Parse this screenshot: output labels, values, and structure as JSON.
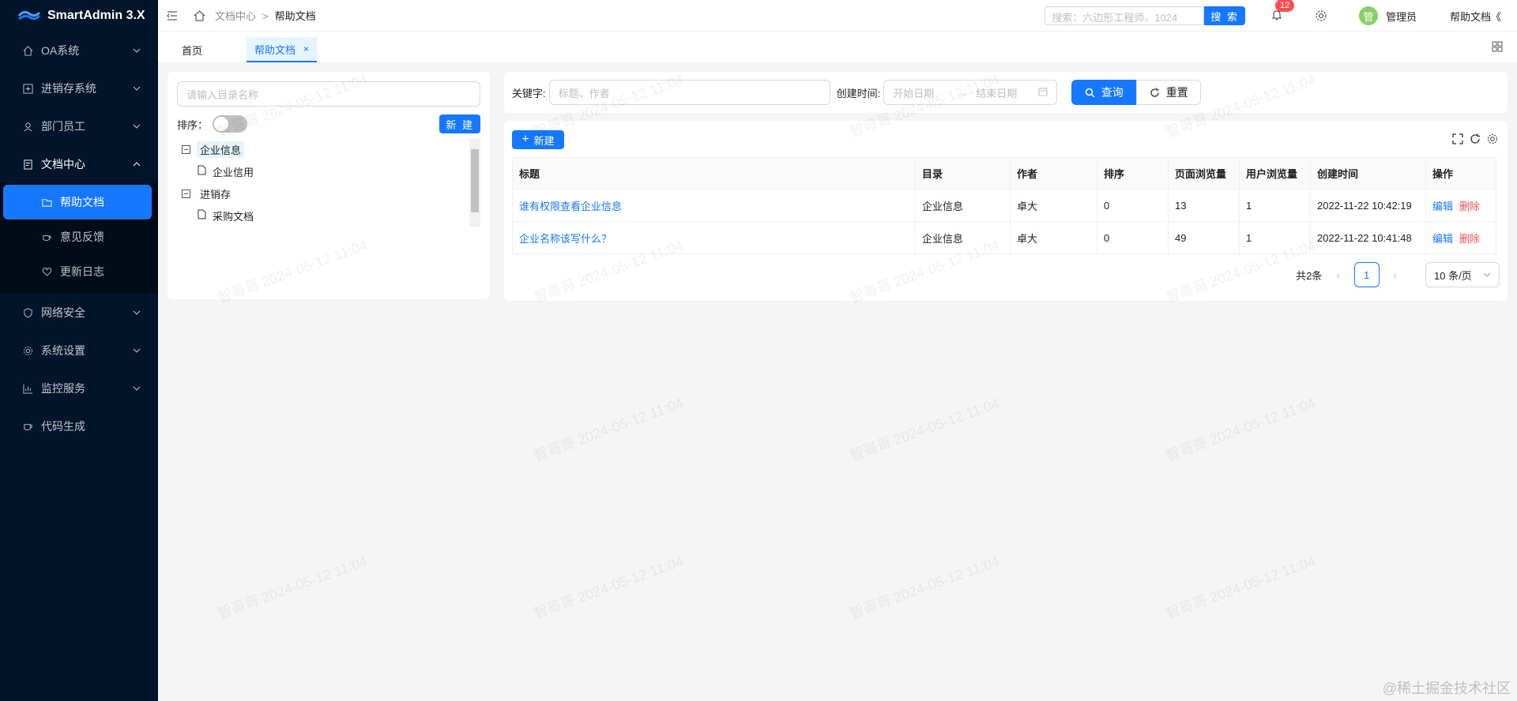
{
  "app": {
    "title": "SmartAdmin 3.X"
  },
  "sidebar": {
    "items": [
      {
        "label": "OA系统",
        "icon": "home-icon"
      },
      {
        "label": "进销存系统",
        "icon": "box-icon"
      },
      {
        "label": "部门员工",
        "icon": "user-icon"
      },
      {
        "label": "文档中心",
        "icon": "doc-icon",
        "open": true,
        "children": [
          {
            "label": "帮助文档",
            "icon": "folder-icon",
            "active": true
          },
          {
            "label": "意见反馈",
            "icon": "coffee-icon"
          },
          {
            "label": "更新日志",
            "icon": "heart-icon"
          }
        ]
      },
      {
        "label": "网络安全",
        "icon": "shield-icon"
      },
      {
        "label": "系统设置",
        "icon": "gear-icon"
      },
      {
        "label": "监控服务",
        "icon": "chart-icon"
      },
      {
        "label": "代码生成",
        "icon": "cup-icon"
      }
    ]
  },
  "header": {
    "breadcrumb": [
      "文档中心",
      "帮助文档"
    ],
    "separator": ">",
    "search_placeholder": "搜索：六边形工程师、1024",
    "search_button": "搜 索",
    "notification_count": "12",
    "avatar_text": "管",
    "user_name": "管理员",
    "help_doc": "帮助文档《"
  },
  "tabs": [
    {
      "label": "首页",
      "active": false
    },
    {
      "label": "帮助文档",
      "active": true,
      "close": "×"
    }
  ],
  "left_panel": {
    "search_placeholder": "请输入目录名称",
    "sort_label": "排序：",
    "new_button": "新 建",
    "tree": [
      {
        "label": "企业信息",
        "children": [
          "企业信用"
        ]
      },
      {
        "label": "进销存",
        "children": [
          "采购文档"
        ]
      }
    ]
  },
  "query": {
    "keyword_label": "关键字:",
    "keyword_placeholder": "标题、作者",
    "created_label": "创建时间:",
    "start_placeholder": "开始日期",
    "range_arrow": "→",
    "end_placeholder": "结束日期",
    "query_button": "查询",
    "reset_button": "重置"
  },
  "table": {
    "new_button": "新建",
    "columns": [
      "标题",
      "目录",
      "作者",
      "排序",
      "页面浏览量",
      "用户浏览量",
      "创建时间",
      "操作"
    ],
    "rows": [
      {
        "title": "谁有权限查看企业信息",
        "catalog": "企业信息",
        "author": "卓大",
        "sort": "0",
        "page_views": "13",
        "user_views": "1",
        "created": "2022-11-22 10:42:19",
        "edit": "编辑",
        "delete": "删除"
      },
      {
        "title": "企业名称该写什么？",
        "catalog": "企业信息",
        "author": "卓大",
        "sort": "0",
        "page_views": "49",
        "user_views": "1",
        "created": "2022-11-22 10:41:48",
        "edit": "编辑",
        "delete": "删除"
      }
    ],
    "pagination": {
      "total": "共2条",
      "current": "1",
      "page_size": "10 条/页"
    }
  },
  "watermark": "智哥哥 2024-05-12 11:04",
  "corner_mark": "@稀土掘金技术社区",
  "colors": {
    "primary": "#1677ff",
    "sidebar": "#001529",
    "danger": "#ff4d4f"
  }
}
